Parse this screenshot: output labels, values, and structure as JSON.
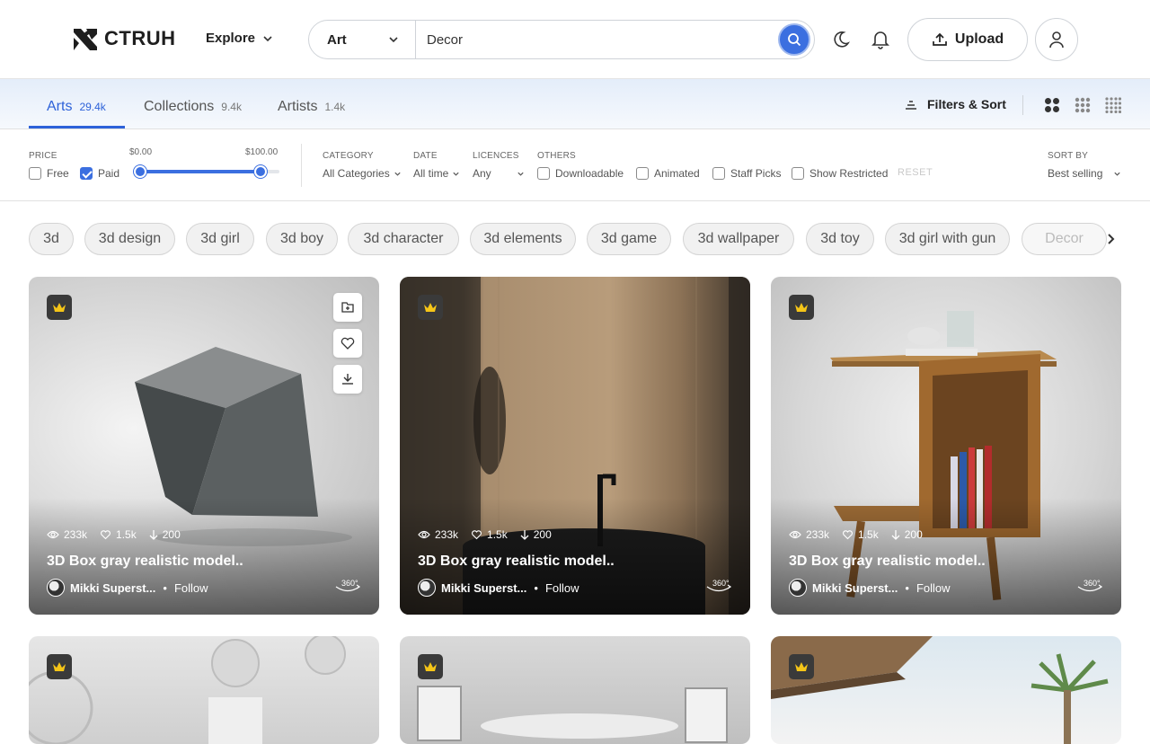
{
  "header": {
    "logo_text": "CTRUH",
    "explore_label": "Explore",
    "search_category": "Art",
    "search_value": "Decor",
    "upload_label": "Upload"
  },
  "tabs": [
    {
      "label": "Arts",
      "count": "29.4k"
    },
    {
      "label": "Collections",
      "count": "9.4k"
    },
    {
      "label": "Artists",
      "count": "1.4k"
    }
  ],
  "filters_sort_label": "Filters & Sort",
  "filters": {
    "price_label": "PRICE",
    "price_min": "$0.00",
    "price_max": "$100.00",
    "free_label": "Free",
    "paid_label": "Paid",
    "category_label": "CATEGORY",
    "category_value": "All Categories",
    "date_label": "DATE",
    "date_value": "All time",
    "licences_label": "LICENCES",
    "licences_value": "Any",
    "others_label": "OTHERS",
    "downloadable": "Downloadable",
    "animated": "Animated",
    "staff_picks": "Staff Picks",
    "show_restricted": "Show Restricted",
    "reset": "RESET",
    "sortby_label": "SORT BY",
    "sortby_value": "Best selling"
  },
  "chips": [
    "3d",
    "3d design",
    "3d girl",
    "3d boy",
    "3d character",
    "3d elements",
    "3d game",
    "3d wallpaper",
    "3d toy",
    "3d girl with gun",
    "Decor"
  ],
  "cards": [
    {
      "views": "233k",
      "likes": "1.5k",
      "downloads": "200",
      "title": "3D Box gray realistic model..",
      "author": "Mikki Superst...",
      "follow": "Follow"
    },
    {
      "views": "233k",
      "likes": "1.5k",
      "downloads": "200",
      "title": "3D Box gray realistic model..",
      "author": "Mikki Superst...",
      "follow": "Follow"
    },
    {
      "views": "233k",
      "likes": "1.5k",
      "downloads": "200",
      "title": "3D Box gray realistic model..",
      "author": "Mikki Superst...",
      "follow": "Follow"
    }
  ],
  "colors": {
    "accent": "#3b6fe0",
    "crown": "#f5c518"
  }
}
